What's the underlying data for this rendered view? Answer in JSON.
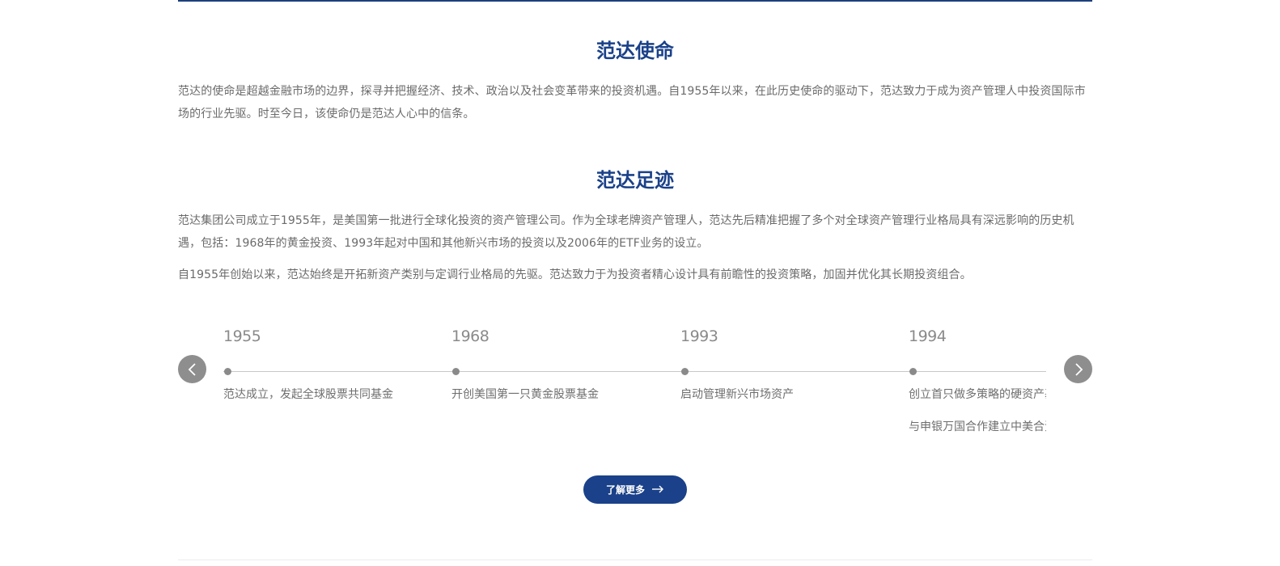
{
  "mission": {
    "title": "范达使命",
    "text": "范达的使命是超越金融市场的边界，探寻并把握经济、技术、政治以及社会变革带来的投资机遇。自1955年以来，在此历史使命的驱动下，范达致力于成为资产管理人中投资国际市场的行业先驱。时至今日，该使命仍是范达人心中的信条。"
  },
  "footprint": {
    "title": "范达足迹",
    "paragraphs": [
      "范达集团公司成立于1955年，是美国第一批进行全球化投资的资产管理公司。作为全球老牌资产管理人，范达先后精准把握了多个对全球资产管理行业格局具有深远影响的历史机遇，包括：1968年的黄金投资、1993年起对中国和其他新兴市场的投资以及2006年的ETF业务的设立。",
      "自1955年创始以来，范达始终是开拓新资产类别与定调行业格局的先驱。范达致力于为投资者精心设计具有前瞻性的投资策略，加固并优化其长期投资组合。"
    ]
  },
  "timeline": {
    "items": [
      {
        "year": "1955",
        "events": [
          "范达成立，发起全球股票共同基金"
        ]
      },
      {
        "year": "1968",
        "events": [
          "开创美国第一只黄金股票基金"
        ]
      },
      {
        "year": "1993",
        "events": [
          "启动管理新兴市场资产"
        ]
      },
      {
        "year": "1994",
        "events": [
          "创立首只做多策略的硬资产基金",
          "与申银万国合作建立中美合资"
        ]
      }
    ],
    "prev_icon": "chevron-left-icon",
    "next_icon": "chevron-right-icon"
  },
  "cta": {
    "label": "了解更多",
    "icon": "arrow-right-icon"
  },
  "colors": {
    "brand": "#1a4189",
    "nav_button": "#8e8e8e"
  }
}
